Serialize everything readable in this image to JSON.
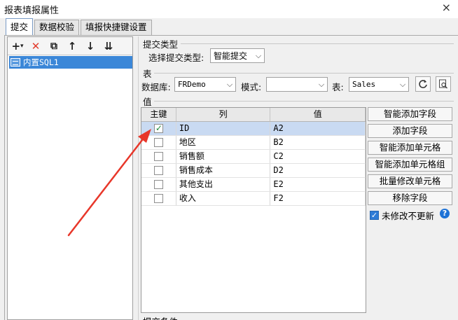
{
  "window": {
    "title": "报表填报属性",
    "close_glyph": "×"
  },
  "tabs": [
    {
      "label": "提交",
      "active": true
    },
    {
      "label": "数据校验",
      "active": false
    },
    {
      "label": "填报快捷键设置",
      "active": false
    }
  ],
  "left_toolbar": {
    "add": "+",
    "add_dropdown": "▾",
    "delete": "✕",
    "copy": "⧉",
    "move_up": "↑",
    "move_down": "↓",
    "sort": "⇊"
  },
  "left_list": [
    {
      "label": "内置SQL1",
      "icon": "sql-table-icon"
    }
  ],
  "submit_type": {
    "section_label": "提交类型",
    "select_label": "选择提交类型:",
    "selected": "智能提交"
  },
  "table_section": {
    "section_label": "表",
    "db_label": "数据库:",
    "db_value": "FRDemo",
    "mode_label": "模式:",
    "mode_value": "",
    "table_label": "表:",
    "table_value": "Sales"
  },
  "values_section": {
    "section_label": "值",
    "headers": {
      "key": "主键",
      "column": "列",
      "value": "值"
    },
    "rows": [
      {
        "checked": true,
        "column": "ID",
        "value": "A2"
      },
      {
        "checked": false,
        "column": "地区",
        "value": "B2"
      },
      {
        "checked": false,
        "column": "销售额",
        "value": "C2"
      },
      {
        "checked": false,
        "column": "销售成本",
        "value": "D2"
      },
      {
        "checked": false,
        "column": "其他支出",
        "value": "E2"
      },
      {
        "checked": false,
        "column": "收入",
        "value": "F2"
      }
    ]
  },
  "right_buttons": [
    "智能添加字段",
    "添加字段",
    "智能添加单元格",
    "智能添加单元格组",
    "批量修改单元格",
    "移除字段"
  ],
  "no_update_option": {
    "label": "未修改不更新",
    "checked": true
  },
  "help_glyph": "?",
  "bottom_section_label": "提交条件",
  "colors": {
    "selection": "#3b87d8",
    "annotation_arrow": "#e8372a",
    "row_highlight": "#c9daf2"
  }
}
